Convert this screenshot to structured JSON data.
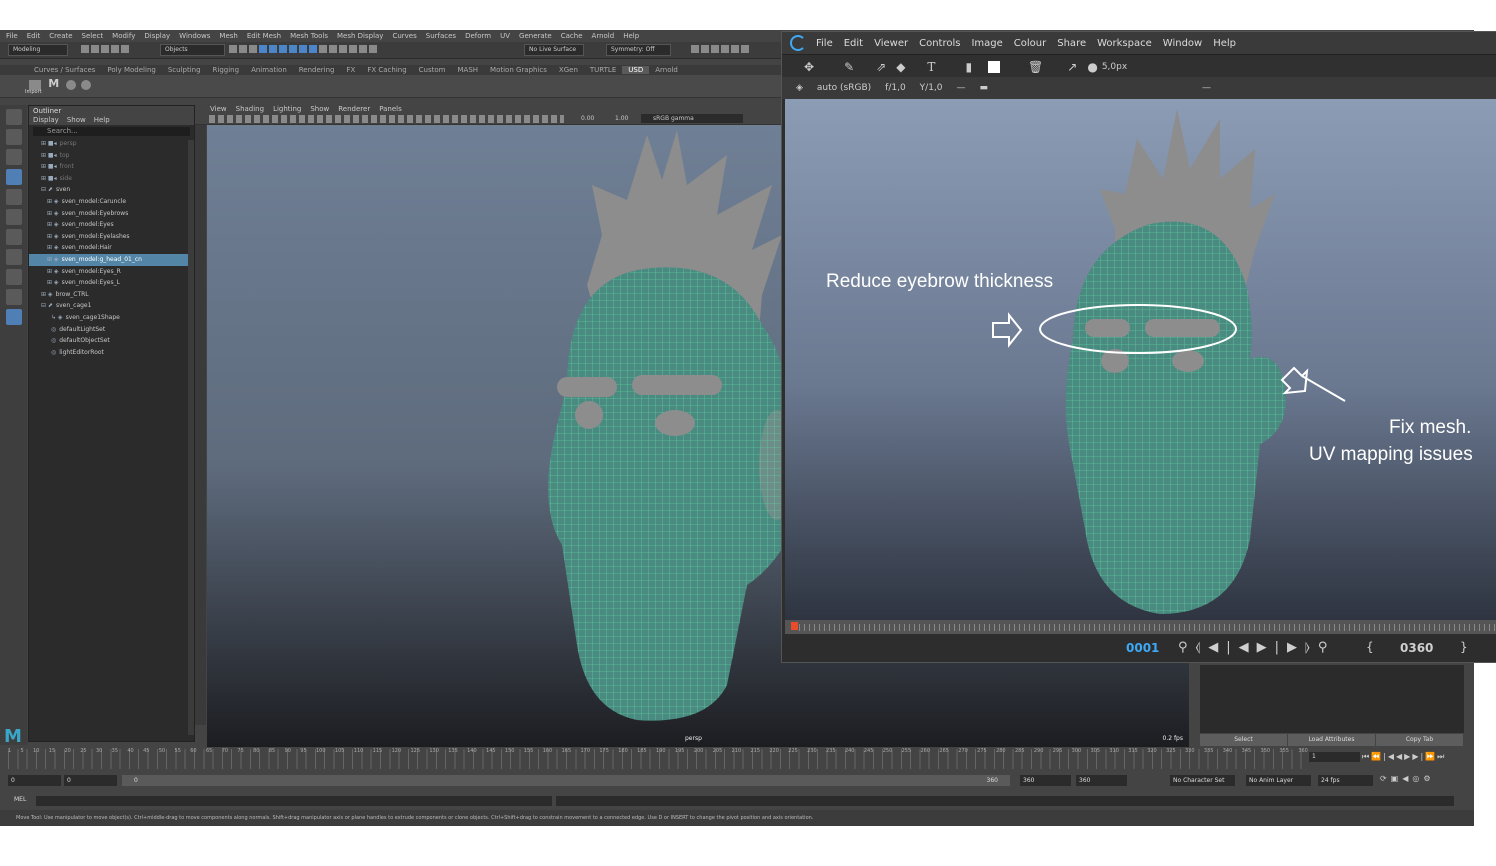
{
  "maya": {
    "menus": [
      "File",
      "Edit",
      "Create",
      "Select",
      "Modify",
      "Display",
      "Windows",
      "Mesh",
      "Edit Mesh",
      "Mesh Tools",
      "Mesh Display",
      "Curves",
      "Surfaces",
      "Deform",
      "UV",
      "Generate",
      "Cache",
      "Arnold",
      "Help"
    ],
    "statusline": {
      "mode": "Modeling",
      "objects": "Objects",
      "live_surface": "No Live Surface",
      "symmetry": "Symmetry: Off"
    },
    "shelf_tabs": [
      "Curves / Surfaces",
      "Poly Modeling",
      "Sculpting",
      "Rigging",
      "Animation",
      "Rendering",
      "FX",
      "FX Caching",
      "Custom",
      "MASH",
      "Motion Graphics",
      "XGen",
      "TURTLE",
      "USD",
      "Arnold"
    ],
    "shelf_active_tab": "USD",
    "shelf_import_label": "Import",
    "outliner": {
      "title": "Outliner",
      "menus": [
        "Display",
        "Show",
        "Help"
      ],
      "search_placeholder": "Search...",
      "items": [
        {
          "label": "persp",
          "style": "dim",
          "prefix": "⊞ ■◂",
          "indent": 12
        },
        {
          "label": "top",
          "style": "dim",
          "prefix": "⊞ ■◂",
          "indent": 12
        },
        {
          "label": "front",
          "style": "dim",
          "prefix": "⊞ ■◂",
          "indent": 12
        },
        {
          "label": "side",
          "style": "dim",
          "prefix": "⊞ ■◂",
          "indent": 12
        },
        {
          "label": "sven",
          "style": "group",
          "prefix": "⊟ ⬈",
          "indent": 12
        },
        {
          "label": "sven_model:Caruncle",
          "style": "",
          "prefix": "⊞ ◈",
          "indent": 18
        },
        {
          "label": "sven_model:Eyebrows",
          "style": "",
          "prefix": "⊞ ◈",
          "indent": 18
        },
        {
          "label": "sven_model:Eyes",
          "style": "",
          "prefix": "⊞ ◈",
          "indent": 18
        },
        {
          "label": "sven_model:Eyelashes",
          "style": "",
          "prefix": "⊞ ◈",
          "indent": 18
        },
        {
          "label": "sven_model:Hair",
          "style": "",
          "prefix": "⊞ ◈",
          "indent": 18
        },
        {
          "label": "sven_model:g_head_01_cn",
          "style": "sel",
          "prefix": "⊞ ◈",
          "indent": 18
        },
        {
          "label": "sven_model:Eyes_R",
          "style": "",
          "prefix": "⊞ ◈",
          "indent": 18
        },
        {
          "label": "sven_model:Eyes_L",
          "style": "",
          "prefix": "⊞ ◈",
          "indent": 18
        },
        {
          "label": "brow_CTRL",
          "style": "",
          "prefix": "⊞ ◈",
          "indent": 12
        },
        {
          "label": "sven_cage1",
          "style": "",
          "prefix": "⊟ ⬈",
          "indent": 12
        },
        {
          "label": "sven_cage1Shape",
          "style": "",
          "prefix": "↳ ◈",
          "indent": 22
        },
        {
          "label": "defaultLightSet",
          "style": "",
          "prefix": "◎",
          "indent": 22
        },
        {
          "label": "defaultObjectSet",
          "style": "",
          "prefix": "◎",
          "indent": 22
        },
        {
          "label": "lightEditorRoot",
          "style": "",
          "prefix": "◎",
          "indent": 22
        }
      ]
    },
    "panel_menus": [
      "View",
      "Shading",
      "Lighting",
      "Show",
      "Renderer",
      "Panels"
    ],
    "viewport_toolbar": {
      "val1": "0.00",
      "val2": "1.00",
      "colorspace": "sRGB gamma"
    },
    "viewport": {
      "camera": "persp",
      "fps": "0.2 fps"
    },
    "channel_box_buttons": [
      "Select",
      "Load Attributes",
      "Copy Tab"
    ],
    "timeline": {
      "ticks": [
        "1",
        "5",
        "10",
        "15",
        "20",
        "25",
        "30",
        "35",
        "40",
        "45",
        "50",
        "55",
        "60",
        "65",
        "70",
        "75",
        "80",
        "85",
        "90",
        "95",
        "100",
        "105",
        "110",
        "115",
        "120",
        "125",
        "130",
        "135",
        "140",
        "145",
        "150",
        "155",
        "160",
        "165",
        "170",
        "175",
        "180",
        "185",
        "190",
        "195",
        "200",
        "205",
        "210",
        "215",
        "220",
        "225",
        "230",
        "235",
        "240",
        "245",
        "250",
        "255",
        "260",
        "265",
        "270",
        "275",
        "280",
        "285",
        "290",
        "295",
        "300",
        "305",
        "310",
        "315",
        "320",
        "325",
        "330",
        "335",
        "340",
        "345",
        "350",
        "355",
        "360"
      ],
      "current_frame": "1"
    },
    "range": {
      "start": "0",
      "anim_start": "0",
      "slider_start": "0",
      "slider_end": "360",
      "anim_end": "360",
      "end": "360",
      "character_set": "No Character Set",
      "anim_layer": "No Anim Layer",
      "fps": "24 fps"
    },
    "mel_label": "MEL",
    "help_line": "Move Tool: Use manipulator to move object(s). Ctrl+middle-drag to move components along normals. Shift+drag manipulator axis or plane handles to extrude components or clone objects. Ctrl+Shift+drag to constrain movement to a connected edge. Use D or INSERT to change the pivot position and axis orientation."
  },
  "review": {
    "menus": [
      "File",
      "Edit",
      "Viewer",
      "Controls",
      "Image",
      "Colour",
      "Share",
      "Workspace",
      "Window",
      "Help"
    ],
    "brush_size": "5,0px",
    "colorspace": "auto (sRGB)",
    "fstop": "f/1,0",
    "gamma": "Y/1,0",
    "current_frame": "0001",
    "end_frame": "0360",
    "annotations": {
      "eyebrow": "Reduce eyebrow thickness",
      "mesh_line1": "Fix mesh.",
      "mesh_line2": "UV mapping issues"
    }
  },
  "colors": {
    "accent_blue": "#3fa9f5",
    "playhead_red": "#ea4b2a",
    "selection_blue": "#5285a6",
    "wireframe_green": "#5fe0a8",
    "mesh_grey": "#8d8d8d",
    "maya_teal": "#3aa6c9"
  }
}
